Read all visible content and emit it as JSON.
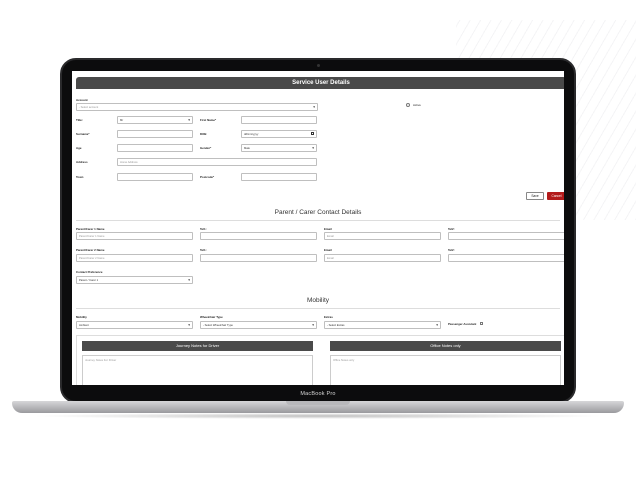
{
  "device": {
    "label": "MacBook Pro"
  },
  "form": {
    "title": "Service User Details",
    "account": {
      "label": "Account",
      "value": "- Select account"
    },
    "active": {
      "label": "Active"
    },
    "title_field": {
      "label": "Title:",
      "value": "Mr"
    },
    "first_name": {
      "label": "First Name*",
      "value": ""
    },
    "surname": {
      "label": "Surname*",
      "value": ""
    },
    "dob": {
      "label": "DOB",
      "value": "dd/mm/yyyy"
    },
    "age": {
      "label": "Age",
      "value": ""
    },
    "gender": {
      "label": "Gender*",
      "value": "Male"
    },
    "address": {
      "label": "Address",
      "placeholder": "Home Address"
    },
    "town": {
      "label": "Town",
      "value": ""
    },
    "postcode": {
      "label": "Postcode*",
      "value": ""
    },
    "save_label": "Save",
    "cancel_label": "Cancel"
  },
  "contacts": {
    "title": "Parent / Carer Contact Details",
    "row1": {
      "name_label": "Parent/Carer 1 Name",
      "name_placeholder": "Parent/Carer 1 Name",
      "tel_label": "Tel1:",
      "email_label": "Email",
      "email_placeholder": "Email",
      "tel2_label": "Tel2:"
    },
    "row2": {
      "name_label": "Parent/Carer 2 Name",
      "name_placeholder": "Parent/Carer 2 Name",
      "tel_label": "Tel1:",
      "email_label": "Email",
      "email_placeholder": "Email",
      "tel2_label": "Tel2:"
    },
    "preference": {
      "label": "Contact Preference",
      "value": "Parent / Carer 1"
    }
  },
  "mobility": {
    "title": "Mobility",
    "mobility_field": {
      "label": "Mobility",
      "value": "Ambient"
    },
    "wheelchair": {
      "label": "Wheelchair Type",
      "value": "- Select Wheelchair Type"
    },
    "extras": {
      "label": "Extras",
      "value": "- Select Extras"
    },
    "passenger_assistant": {
      "label": "Passenger Assistant"
    },
    "driver_notes": {
      "title": "Journey Notes for Driver",
      "placeholder": "Journey Notes For Driver"
    },
    "office_notes": {
      "title": "Office Notes only",
      "placeholder": "Office Notes only"
    }
  },
  "colors": {
    "header_bar": "#4a4a4a",
    "cancel": "#b31b1b"
  }
}
